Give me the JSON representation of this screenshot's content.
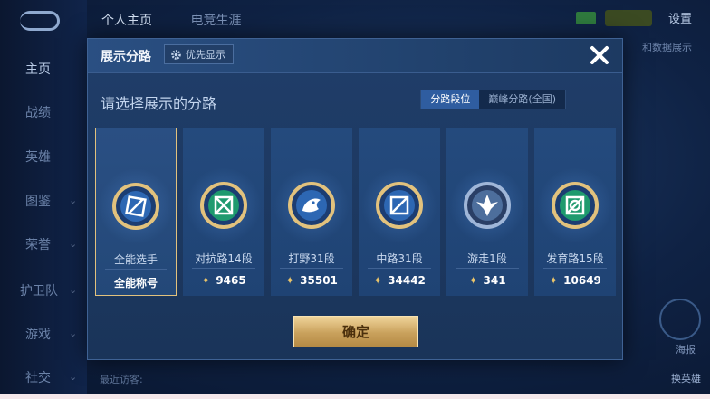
{
  "background": {
    "nav_items": [
      "主页",
      "战绩",
      "英雄",
      "图鉴",
      "荣誉",
      "护卫队",
      "游戏",
      "社交"
    ],
    "top_tabs": [
      "个人主页",
      "电竞生涯"
    ],
    "settings_label": "设置",
    "right_strip_label": "和数据展示",
    "hero_btn_label": "海报",
    "hero_btn2_label": "换英雄",
    "recent_visitors_label": "最近访客:"
  },
  "modal": {
    "title": "展示分路",
    "priority_label": "优先显示",
    "subtitle": "请选择展示的分路",
    "toggle": [
      "分路段位",
      "巅峰分路(全国)"
    ],
    "toggle_active": 0,
    "cards": [
      {
        "label": "全能选手",
        "score": "全能称号",
        "selected": true,
        "emblem": "all-round-icon"
      },
      {
        "label": "对抗路14段",
        "score": "9465",
        "selected": false,
        "emblem": "clash-lane-icon"
      },
      {
        "label": "打野31段",
        "score": "35501",
        "selected": false,
        "emblem": "jungle-icon"
      },
      {
        "label": "中路31段",
        "score": "34442",
        "selected": false,
        "emblem": "mid-lane-icon"
      },
      {
        "label": "游走1段",
        "score": "341",
        "selected": false,
        "emblem": "roam-icon"
      },
      {
        "label": "发育路15段",
        "score": "10649",
        "selected": false,
        "emblem": "farm-lane-icon"
      }
    ],
    "confirm_label": "确定"
  },
  "colors": {
    "accent_gold": "#e2c27d",
    "active_toggle": "#2f5da0",
    "card_bg": "#244a7d"
  }
}
